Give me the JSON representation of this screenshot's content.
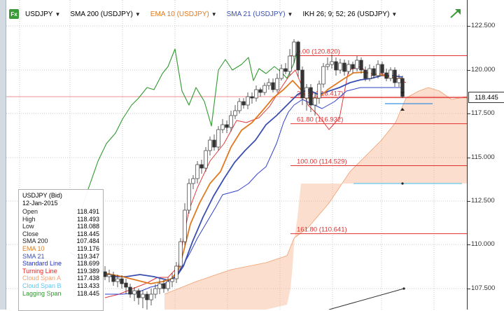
{
  "toolbar": {
    "fx_label": "Fx",
    "symbol": "USDJPY",
    "sma200": "SMA 200 (USDJPY)",
    "ema10": "EMA 10 (USDJPY)",
    "sma21": "SMA 21 (USDJPY)",
    "ikh": "IKH 26; 9; 52; 26 (USDJPY)",
    "arrow": "▼"
  },
  "colors": {
    "ema10": "#e07a1f",
    "sma21": "#3a4fb0",
    "sma200": "#2f9a2f",
    "turning_line": "#e23a3a",
    "standard_line": "#3040c8",
    "cloud_a": "#f0a070",
    "cloud_b": "#60c8f0",
    "fib": "#e03030",
    "last_price_line": "#e03030"
  },
  "price_axis": {
    "ticks": [
      "122.500",
      "120.000",
      "117.500",
      "115.000",
      "112.500",
      "110.000",
      "107.500"
    ],
    "last_price": "118.445"
  },
  "fibonacci": [
    {
      "label": "0.00 (120.820)",
      "price": 120.82
    },
    {
      "label": "38.20 (118.417)",
      "price": 118.417
    },
    {
      "label": "61.80 (116.932)",
      "price": 116.932
    },
    {
      "label": "100.00 (114.529)",
      "price": 114.529
    },
    {
      "label": "161.80 (110.641)",
      "price": 110.641
    }
  ],
  "info_panel": {
    "title": "USDJPY (Bid)",
    "date": "12-Jan-2015",
    "rows": [
      {
        "label": "Open",
        "value": "118.491",
        "color": "#222222"
      },
      {
        "label": "High",
        "value": "118.493",
        "color": "#222222"
      },
      {
        "label": "Low",
        "value": "118.088",
        "color": "#222222"
      },
      {
        "label": "Close",
        "value": "118.445",
        "color": "#222222"
      },
      {
        "label": "SMA 200",
        "value": "107.484",
        "color": "#222222"
      },
      {
        "label": "EMA 10",
        "value": "119.176",
        "color": "#e07a1f"
      },
      {
        "label": "SMA 21",
        "value": "119.347",
        "color": "#3a4fb0"
      },
      {
        "label": "Standard Line",
        "value": "118.699",
        "color": "#2030c0"
      },
      {
        "label": "Turning Line",
        "value": "119.389",
        "color": "#e02020"
      },
      {
        "label": "Cloud Span A",
        "value": "117.438",
        "color": "#f0a070"
      },
      {
        "label": "Cloud Span B",
        "value": "113.433",
        "color": "#60c8f0"
      },
      {
        "label": "Lagging Span",
        "value": "118.445",
        "color": "#2f9a2f"
      }
    ]
  }
}
